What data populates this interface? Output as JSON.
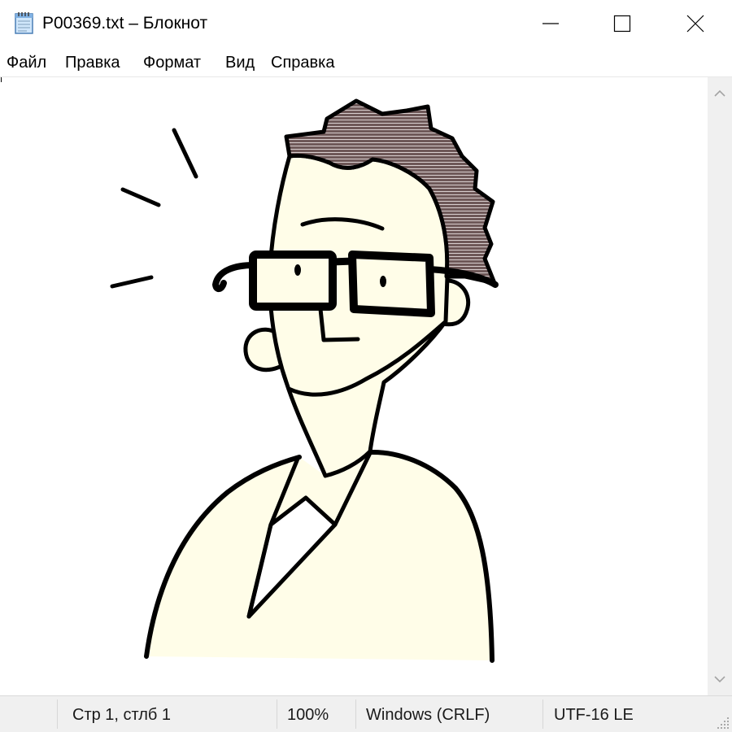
{
  "window": {
    "title": "P00369.txt – Блокнот",
    "app_icon": "notepad-icon",
    "controls": {
      "minimize": "minimize-icon",
      "maximize": "maximize-icon",
      "close": "close-icon"
    }
  },
  "menu": {
    "items": [
      "Файл",
      "Правка",
      "Формат",
      "Вид",
      "Справка"
    ]
  },
  "editor": {
    "content_art": "man-with-glasses-drawing",
    "scrollbar": {
      "up": "chevron-up-icon",
      "down": "chevron-down-icon"
    }
  },
  "status": {
    "position": "Стр 1, стлб 1",
    "zoom": "100%",
    "line_endings": "Windows (CRLF)",
    "encoding": "UTF-16 LE"
  },
  "colors": {
    "statusbar": "#f0f0f0",
    "hair": "#6e5858",
    "skin": "#fffde8",
    "outline": "#000000"
  }
}
